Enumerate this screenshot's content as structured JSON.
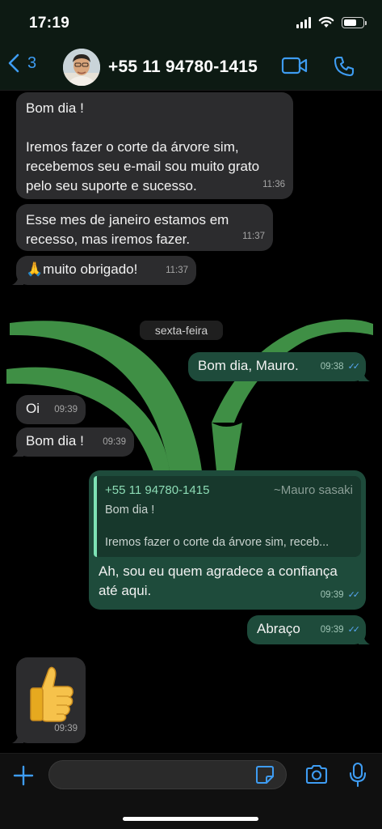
{
  "status_bar": {
    "time": "17:19",
    "battery_level": 0.7
  },
  "header": {
    "back_count": "3",
    "contact_name": "+55 11 94780-1415",
    "accent_color": "#3e9cf2"
  },
  "chat": {
    "date_separator": "sexta-feira",
    "messages": [
      {
        "direction": "in",
        "text": "Bom dia !\n\nIremos fazer o corte da árvore sim,\nrecebemos seu e-mail sou muito grato\npelo seu suporte e sucesso.",
        "time": "11:36"
      },
      {
        "direction": "in",
        "text": "Esse mes de janeiro estamos em\nrecesso, mas iremos fazer.",
        "time": "11:37"
      },
      {
        "direction": "in",
        "text": "🙏muito obrigado!",
        "time": "11:37"
      },
      {
        "direction": "out",
        "text": "Bom dia, Mauro.",
        "time": "09:38",
        "status": "read"
      },
      {
        "direction": "in",
        "text": "Oi",
        "time": "09:39"
      },
      {
        "direction": "in",
        "text": "Bom dia !",
        "time": "09:39"
      },
      {
        "direction": "out",
        "quote": {
          "number": "+55 11 94780-1415",
          "author": "~Mauro sasaki",
          "text": "Bom dia !\n\nIremos fazer o corte da árvore sim, receb..."
        },
        "text": "Ah, sou eu quem agradece a confiança\naté aqui.",
        "time": "09:39",
        "status": "read"
      },
      {
        "direction": "out",
        "text": "Abraço",
        "time": "09:39",
        "status": "read"
      },
      {
        "direction": "in",
        "sticker": "thumbs-up",
        "time": "09:39"
      }
    ]
  },
  "composer": {
    "value": "",
    "placeholder": ""
  },
  "colors": {
    "incoming_bubble": "#2c2c2e",
    "outgoing_bubble": "#1e4b3b",
    "read_ticks": "#58a6f4",
    "wallpaper_green": "#3f8f45"
  }
}
